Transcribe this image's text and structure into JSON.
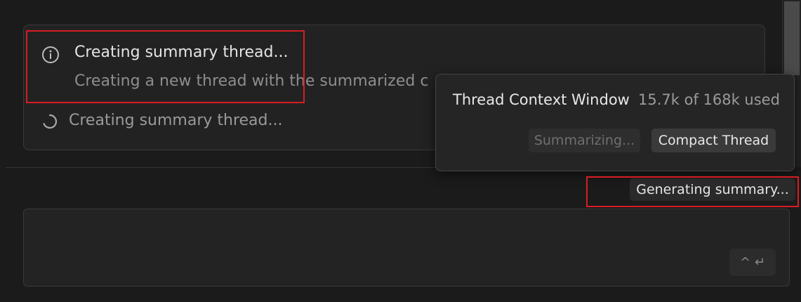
{
  "thread_status": {
    "title": "Creating summary thread...",
    "subtitle": "Creating a new thread with the summarized c",
    "progress": "Creating summary thread..."
  },
  "popup": {
    "title": "Thread Context Window",
    "usage": "15.7k of 168k used",
    "summarizing_button": "Summarizing...",
    "compact_button": "Compact Thread"
  },
  "generating_label": "Generating summary...",
  "send_button": {
    "modifier": "^",
    "enter": "↵"
  },
  "icons": {
    "info": "info-icon",
    "spinner": "spinner-icon"
  },
  "colors": {
    "highlight": "#d81d25",
    "background": "#1b1b1b"
  }
}
